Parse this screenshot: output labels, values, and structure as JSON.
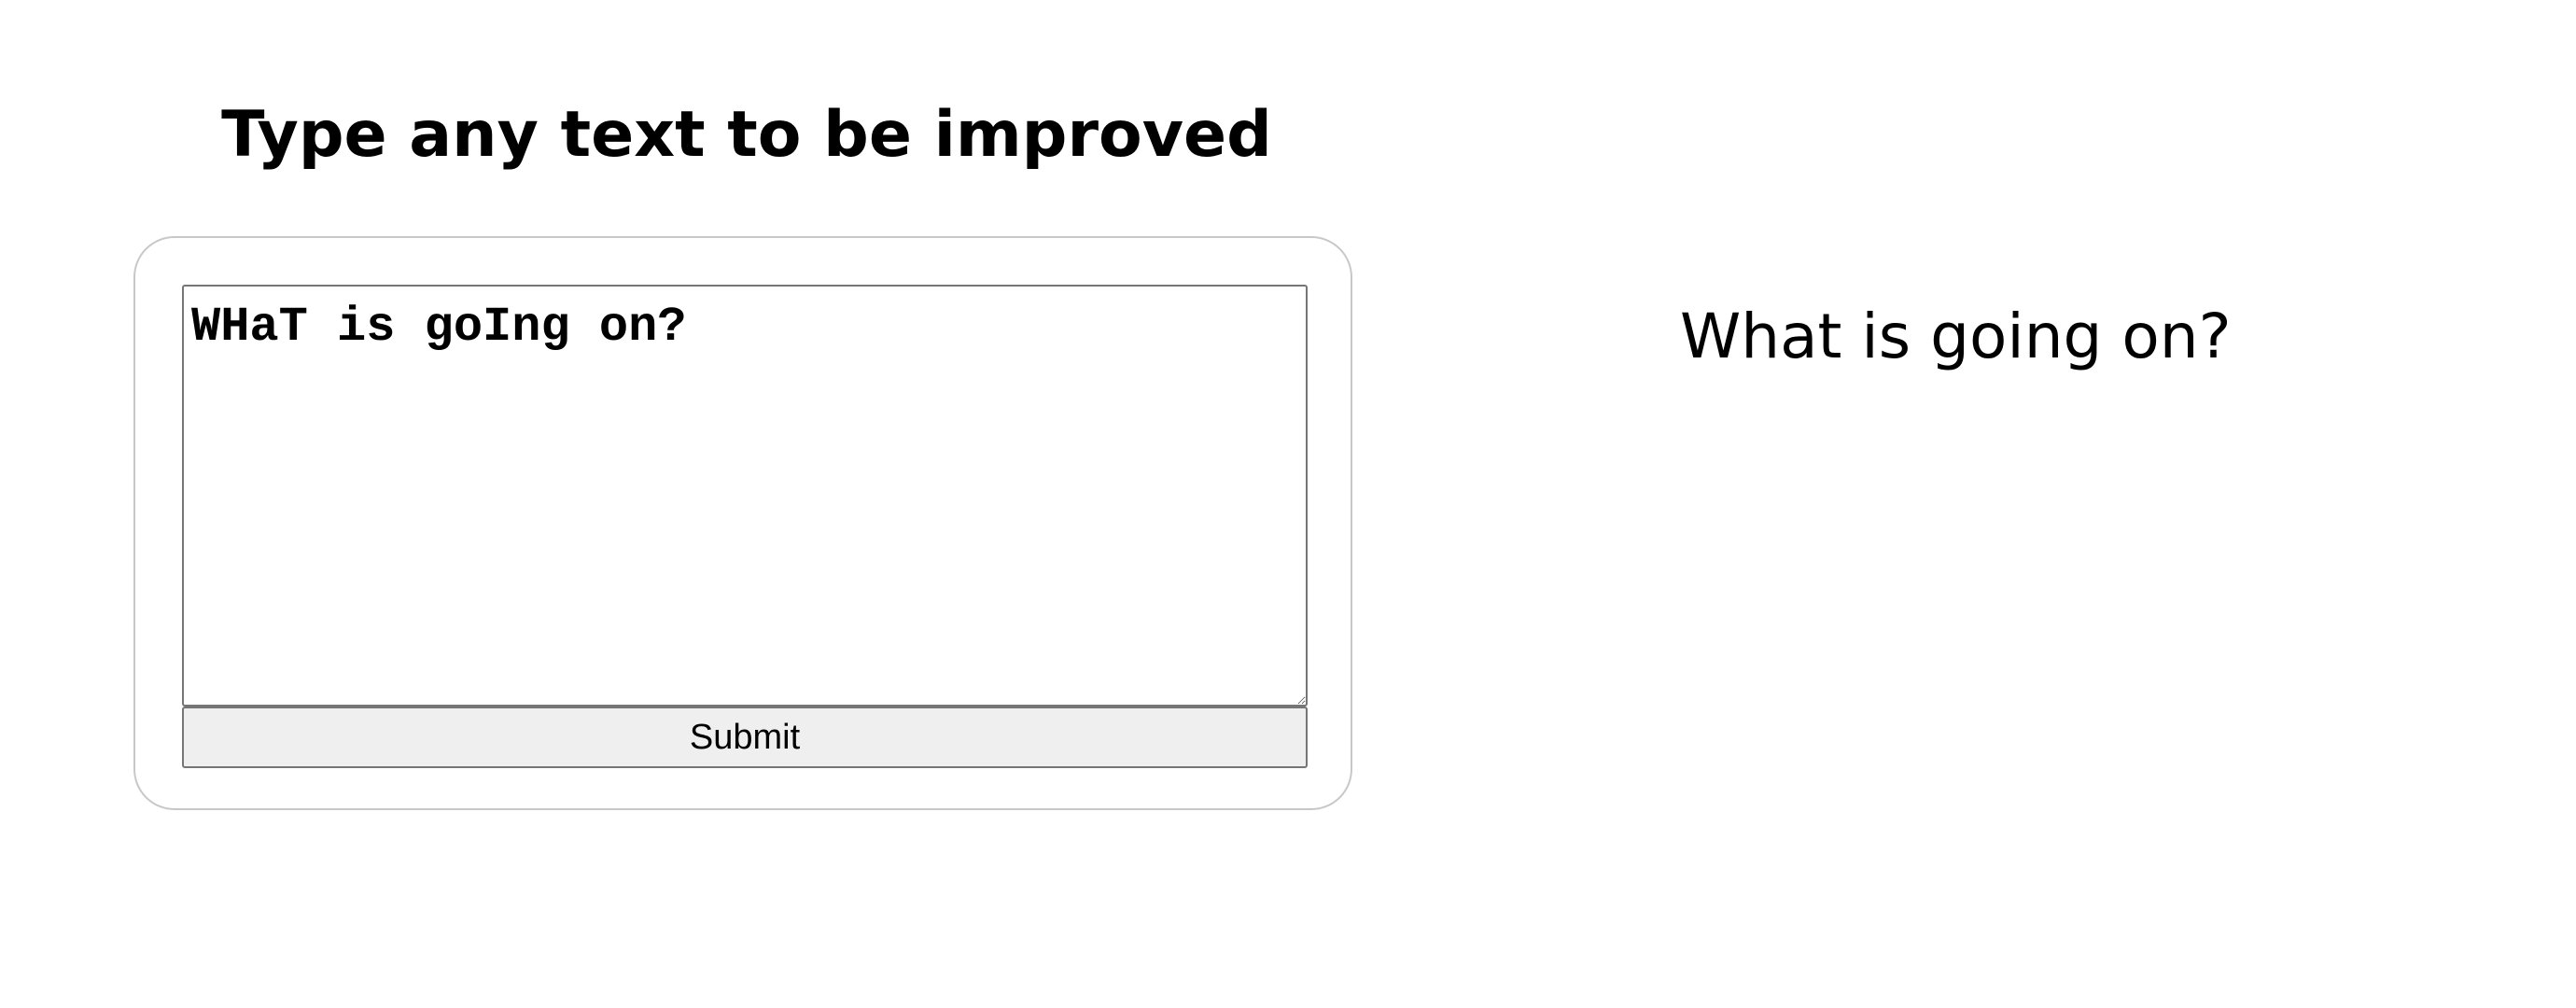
{
  "heading": {
    "title": "Type any text to be improved"
  },
  "form": {
    "input_value": "WHaT is goIng on?",
    "submit_label": "Submit"
  },
  "result": {
    "text": "What is going on?"
  }
}
